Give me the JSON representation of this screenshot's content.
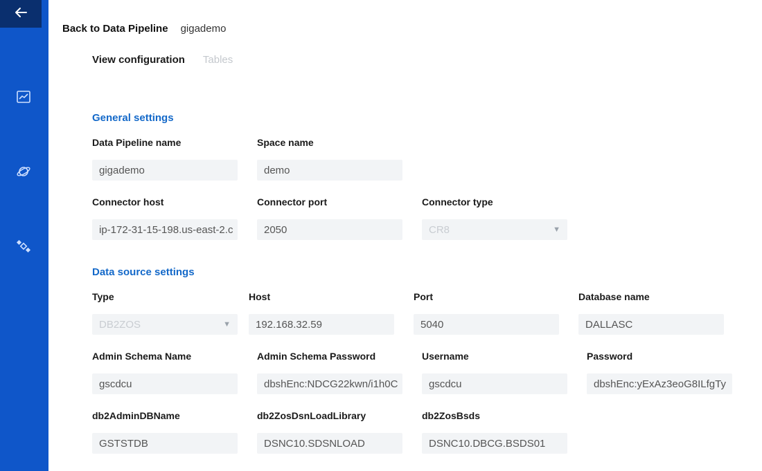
{
  "header": {
    "back_label": "Back to Data Pipeline",
    "pipeline_name": "gigademo"
  },
  "tabs": [
    {
      "label": "View configuration",
      "active": true
    },
    {
      "label": "Tables",
      "active": false
    }
  ],
  "general_settings": {
    "title": "General settings",
    "fields": {
      "pipeline_name": {
        "label": "Data Pipeline name",
        "value": "gigademo"
      },
      "space_name": {
        "label": "Space name",
        "value": "demo"
      },
      "connector_host": {
        "label": "Connector host",
        "value": "ip-172-31-15-198.us-east-2.c"
      },
      "connector_port": {
        "label": "Connector port",
        "value": "2050"
      },
      "connector_type": {
        "label": "Connector type",
        "value": "CR8"
      }
    }
  },
  "data_source_settings": {
    "title": "Data source settings",
    "fields": {
      "type": {
        "label": "Type",
        "value": "DB2ZOS"
      },
      "host": {
        "label": "Host",
        "value": "192.168.32.59"
      },
      "port": {
        "label": "Port",
        "value": "5040"
      },
      "database_name": {
        "label": "Database name",
        "value": "DALLASC"
      },
      "admin_schema_name": {
        "label": "Admin Schema Name",
        "value": "gscdcu"
      },
      "admin_schema_password": {
        "label": "Admin Schema Password",
        "value": "dbshEnc:NDCG22kwn/i1h0C"
      },
      "username": {
        "label": "Username",
        "value": "gscdcu"
      },
      "password": {
        "label": "Password",
        "value": "dbshEnc:yExAz3eoG8ILfgTy"
      },
      "db2_admin_db_name": {
        "label": "db2AdminDBName",
        "value": "GSTSTDB"
      },
      "db2_zos_dsn_load_library": {
        "label": "db2ZosDsnLoadLibrary",
        "value": "DSNC10.SDSNLOAD"
      },
      "db2_zos_bsds": {
        "label": "db2ZosBsds",
        "value": "DSNC10.DBCG.BSDS01"
      }
    }
  },
  "icons": {
    "back": "arrow-left-icon",
    "nav": [
      "chart-icon",
      "planet-icon",
      "satellite-icon"
    ]
  },
  "colors": {
    "sidebar": "#0f56c9",
    "back_square": "#0a2f6e",
    "section_title": "#1469c9",
    "field_bg": "#f2f4f6"
  }
}
